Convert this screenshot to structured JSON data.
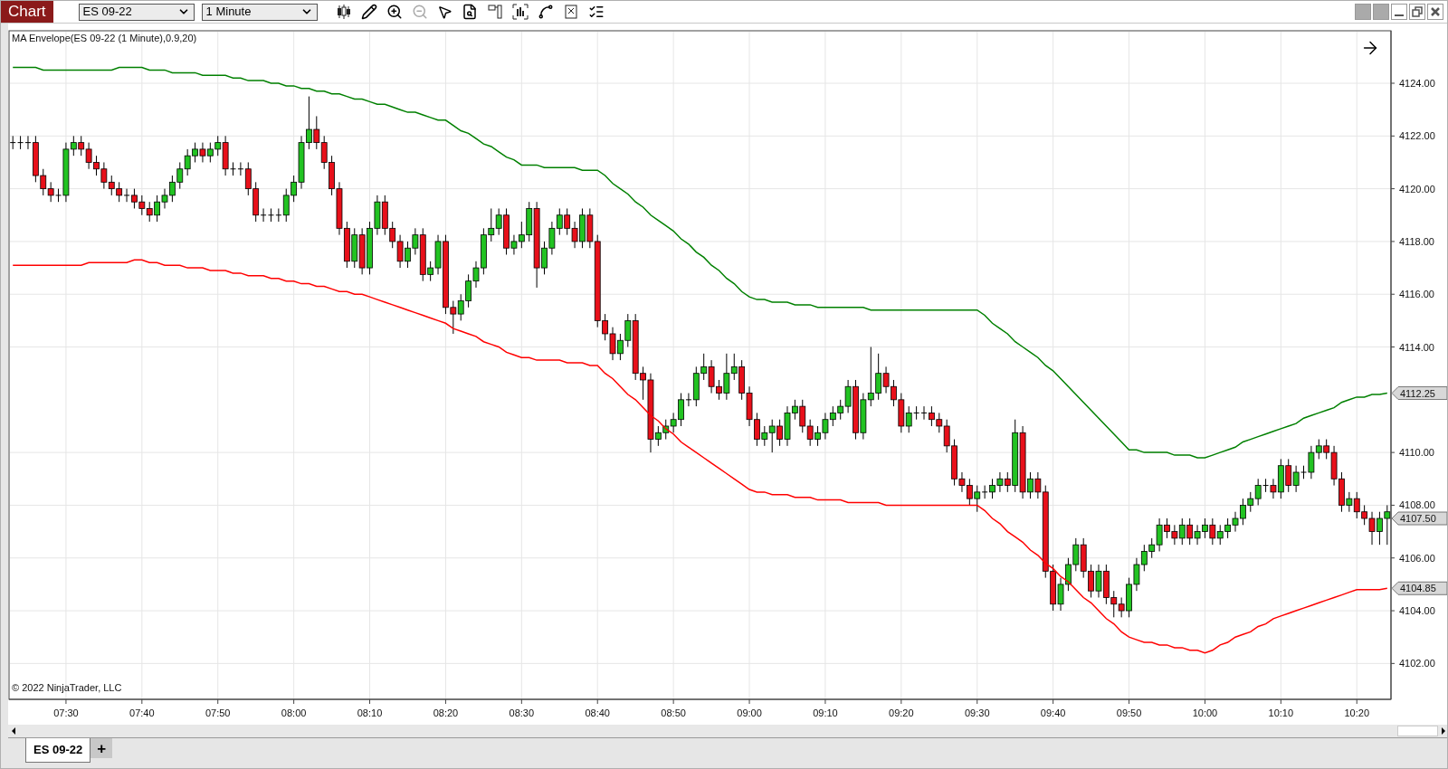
{
  "toolbar": {
    "title": "Chart",
    "instrument": "ES 09-22",
    "interval": "1 Minute"
  },
  "chart": {
    "legend": "MA Envelope(ES 09-22 (1 Minute),0.9,20)",
    "copyright": "© 2022 NinjaTrader, LLC",
    "price_markers": [
      {
        "label": "4112.25"
      },
      {
        "label": "4107.50"
      },
      {
        "label": "4104.85"
      }
    ],
    "chart_data": {
      "type": "candlestick",
      "grid": true,
      "ylim": [
        4100.64,
        4125.99
      ],
      "categories": [
        null,
        null,
        null,
        null,
        null,
        null,
        null,
        "07:30",
        null,
        null,
        null,
        null,
        null,
        null,
        null,
        null,
        null,
        "07:40",
        null,
        null,
        null,
        null,
        null,
        null,
        null,
        null,
        null,
        "07:50",
        null,
        null,
        null,
        null,
        null,
        null,
        null,
        null,
        null,
        "08:00",
        null,
        null,
        null,
        null,
        null,
        null,
        null,
        null,
        null,
        "08:10",
        null,
        null,
        null,
        null,
        null,
        null,
        null,
        null,
        null,
        "08:20",
        null,
        null,
        null,
        null,
        null,
        null,
        null,
        null,
        null,
        "08:30",
        null,
        null,
        null,
        null,
        null,
        null,
        null,
        null,
        null,
        "08:40",
        null,
        null,
        null,
        null,
        null,
        null,
        null,
        null,
        null,
        "08:50",
        null,
        null,
        null,
        null,
        null,
        null,
        null,
        null,
        null,
        "09:00",
        null,
        null,
        null,
        null,
        null,
        null,
        null,
        null,
        null,
        "09:10",
        null,
        null,
        null,
        null,
        null,
        null,
        null,
        null,
        null,
        "09:20",
        null,
        null,
        null,
        null,
        null,
        null,
        null,
        null,
        null,
        "09:30",
        null,
        null,
        null,
        null,
        null,
        null,
        null,
        null,
        null,
        "09:40",
        null,
        null,
        null,
        null,
        null,
        null,
        null,
        null,
        null,
        "09:50",
        null,
        null,
        null,
        null,
        null,
        null,
        null,
        null,
        null,
        "10:00",
        null,
        null,
        null,
        null,
        null,
        null,
        null,
        null,
        null,
        "10:10",
        null,
        null,
        null,
        null,
        null,
        null,
        null,
        null,
        null,
        "10:20",
        null,
        null,
        null,
        null
      ],
      "ohlc": [
        [
          4121.75,
          4122,
          4121.5,
          4121.75
        ],
        [
          4121.75,
          4122,
          4121.5,
          4121.75
        ],
        [
          4121.75,
          4122,
          4121.5,
          4121.75
        ],
        [
          4121.75,
          4122,
          4120.25,
          4120.5
        ],
        [
          4120.5,
          4120.75,
          4119.75,
          4120
        ],
        [
          4120,
          4120.25,
          4119.5,
          4119.75
        ],
        [
          4119.75,
          4120,
          4119.5,
          4119.75
        ],
        [
          4119.75,
          4121.75,
          4119.5,
          4121.5
        ],
        [
          4121.5,
          4122,
          4121.25,
          4121.75
        ],
        [
          4121.75,
          4122,
          4121.25,
          4121.5
        ],
        [
          4121.5,
          4121.75,
          4120.75,
          4121
        ],
        [
          4121,
          4121.25,
          4120.5,
          4120.75
        ],
        [
          4120.75,
          4121,
          4120,
          4120.25
        ],
        [
          4120.25,
          4120.5,
          4119.75,
          4120
        ],
        [
          4120,
          4120.25,
          4119.5,
          4119.75
        ],
        [
          4119.75,
          4120,
          4119.5,
          4119.75
        ],
        [
          4119.75,
          4120,
          4119.25,
          4119.5
        ],
        [
          4119.5,
          4119.75,
          4119,
          4119.25
        ],
        [
          4119.25,
          4119.5,
          4118.75,
          4119
        ],
        [
          4119,
          4119.75,
          4118.75,
          4119.5
        ],
        [
          4119.5,
          4120,
          4119.25,
          4119.75
        ],
        [
          4119.75,
          4120.5,
          4119.5,
          4120.25
        ],
        [
          4120.25,
          4121,
          4120,
          4120.75
        ],
        [
          4120.75,
          4121.5,
          4120.5,
          4121.25
        ],
        [
          4121.25,
          4121.75,
          4121,
          4121.5
        ],
        [
          4121.5,
          4121.75,
          4121,
          4121.25
        ],
        [
          4121.25,
          4121.75,
          4121,
          4121.5
        ],
        [
          4121.5,
          4122,
          4121.25,
          4121.75
        ],
        [
          4121.75,
          4122,
          4120.5,
          4120.75
        ],
        [
          4120.75,
          4121,
          4120.5,
          4120.75
        ],
        [
          4120.75,
          4121,
          4120.5,
          4120.75
        ],
        [
          4120.75,
          4121,
          4119.75,
          4120
        ],
        [
          4120,
          4120.25,
          4118.75,
          4119
        ],
        [
          4119,
          4119.25,
          4118.75,
          4119
        ],
        [
          4119,
          4119.25,
          4118.75,
          4119
        ],
        [
          4119,
          4119.25,
          4118.75,
          4119
        ],
        [
          4119,
          4120,
          4118.75,
          4119.75
        ],
        [
          4119.75,
          4120.5,
          4119.5,
          4120.25
        ],
        [
          4120.25,
          4122,
          4120,
          4121.75
        ],
        [
          4121.75,
          4123.5,
          4121.5,
          4122.25
        ],
        [
          4122.25,
          4122.75,
          4121.5,
          4121.75
        ],
        [
          4121.75,
          4122,
          4120.75,
          4121
        ],
        [
          4121,
          4121.25,
          4119.75,
          4120
        ],
        [
          4120,
          4120.25,
          4118.25,
          4118.5
        ],
        [
          4118.5,
          4118.75,
          4117,
          4117.25
        ],
        [
          4117.25,
          4118.5,
          4117,
          4118.25
        ],
        [
          4118.25,
          4118.5,
          4116.75,
          4117
        ],
        [
          4117,
          4118.75,
          4116.75,
          4118.5
        ],
        [
          4118.5,
          4119.75,
          4118.25,
          4119.5
        ],
        [
          4119.5,
          4119.75,
          4118.25,
          4118.5
        ],
        [
          4118.5,
          4118.75,
          4117.75,
          4118
        ],
        [
          4118,
          4118.25,
          4117,
          4117.25
        ],
        [
          4117.25,
          4118,
          4117,
          4117.75
        ],
        [
          4117.75,
          4118.5,
          4117.5,
          4118.25
        ],
        [
          4118.25,
          4118.5,
          4116.5,
          4116.75
        ],
        [
          4116.75,
          4117.25,
          4116.5,
          4117
        ],
        [
          4117,
          4118.25,
          4116.75,
          4118
        ],
        [
          4118,
          4118.25,
          4115.25,
          4115.5
        ],
        [
          4115.5,
          4115.75,
          4114.5,
          4115.25
        ],
        [
          4115.25,
          4116,
          4115,
          4115.75
        ],
        [
          4115.75,
          4116.75,
          4115.5,
          4116.5
        ],
        [
          4116.5,
          4117.25,
          4116.25,
          4117
        ],
        [
          4117,
          4118.5,
          4116.75,
          4118.25
        ],
        [
          4118.25,
          4119.25,
          4118,
          4118.5
        ],
        [
          4118.5,
          4119.25,
          4118.25,
          4119
        ],
        [
          4119,
          4119.25,
          4117.5,
          4117.75
        ],
        [
          4117.75,
          4118.25,
          4117.5,
          4118
        ],
        [
          4118,
          4118.75,
          4117.75,
          4118.25
        ],
        [
          4118.25,
          4119.5,
          4118,
          4119.25
        ],
        [
          4119.25,
          4119.5,
          4116.25,
          4117
        ],
        [
          4117,
          4118,
          4116.75,
          4117.75
        ],
        [
          4117.75,
          4118.75,
          4117.5,
          4118.5
        ],
        [
          4118.5,
          4119.25,
          4118.25,
          4119
        ],
        [
          4119,
          4119.25,
          4118.25,
          4118.5
        ],
        [
          4118.5,
          4118.75,
          4117.75,
          4118
        ],
        [
          4118,
          4119.25,
          4117.75,
          4119
        ],
        [
          4119,
          4119.25,
          4117.75,
          4118
        ],
        [
          4118,
          4118.25,
          4114.75,
          4115
        ],
        [
          4115,
          4115.25,
          4114.25,
          4114.5
        ],
        [
          4114.5,
          4114.75,
          4113.5,
          4113.75
        ],
        [
          4113.75,
          4114.5,
          4113.5,
          4114.25
        ],
        [
          4114.25,
          4115.25,
          4114,
          4115
        ],
        [
          4115,
          4115.25,
          4112.75,
          4113
        ],
        [
          4113,
          4113.25,
          4112,
          4112.75
        ],
        [
          4112.75,
          4113,
          4110,
          4110.5
        ],
        [
          4110.5,
          4111,
          4110.25,
          4110.75
        ],
        [
          4110.75,
          4111.25,
          4110.5,
          4111
        ],
        [
          4111,
          4111.5,
          4110.75,
          4111.25
        ],
        [
          4111.25,
          4112.25,
          4111,
          4112
        ],
        [
          4112,
          4112.25,
          4111.75,
          4112
        ],
        [
          4112,
          4113.25,
          4111.75,
          4113
        ],
        [
          4113,
          4113.75,
          4112.75,
          4113.25
        ],
        [
          4113.25,
          4113.5,
          4112.25,
          4112.5
        ],
        [
          4112.5,
          4112.75,
          4112,
          4112.25
        ],
        [
          4112.25,
          4113.75,
          4112,
          4113
        ],
        [
          4113,
          4113.75,
          4112.75,
          4113.25
        ],
        [
          4113.25,
          4113.5,
          4112,
          4112.25
        ],
        [
          4112.25,
          4112.5,
          4111,
          4111.25
        ],
        [
          4111.25,
          4111.5,
          4110.25,
          4110.5
        ],
        [
          4110.5,
          4111,
          4110.25,
          4110.75
        ],
        [
          4110.75,
          4111.25,
          4110,
          4111
        ],
        [
          4111,
          4111.25,
          4110.25,
          4110.5
        ],
        [
          4110.5,
          4111.75,
          4110.25,
          4111.5
        ],
        [
          4111.5,
          4112,
          4111.25,
          4111.75
        ],
        [
          4111.75,
          4112,
          4110.75,
          4111
        ],
        [
          4111,
          4111.25,
          4110.25,
          4110.5
        ],
        [
          4110.5,
          4111,
          4110.25,
          4110.75
        ],
        [
          4110.75,
          4111.5,
          4110.5,
          4111.25
        ],
        [
          4111.25,
          4111.75,
          4111,
          4111.5
        ],
        [
          4111.5,
          4112,
          4111.25,
          4111.75
        ],
        [
          4111.75,
          4112.75,
          4111.5,
          4112.5
        ],
        [
          4112.5,
          4112.75,
          4110.5,
          4110.75
        ],
        [
          4110.75,
          4112.25,
          4110.5,
          4112
        ],
        [
          4112,
          4114,
          4111.75,
          4112.25
        ],
        [
          4112.25,
          4113.75,
          4112,
          4113
        ],
        [
          4113,
          4113.25,
          4112.25,
          4112.5
        ],
        [
          4112.5,
          4112.75,
          4111.75,
          4112
        ],
        [
          4112,
          4112.25,
          4110.75,
          4111
        ],
        [
          4111,
          4111.75,
          4110.75,
          4111.5
        ],
        [
          4111.5,
          4111.75,
          4111.25,
          4111.5
        ],
        [
          4111.5,
          4111.75,
          4111.25,
          4111.5
        ],
        [
          4111.5,
          4111.75,
          4111,
          4111.25
        ],
        [
          4111.25,
          4111.5,
          4110.75,
          4111
        ],
        [
          4111,
          4111.25,
          4110,
          4110.25
        ],
        [
          4110.25,
          4110.5,
          4108.75,
          4109
        ],
        [
          4109,
          4109.25,
          4108.5,
          4108.75
        ],
        [
          4108.75,
          4109,
          4108,
          4108.25
        ],
        [
          4108.25,
          4108.75,
          4107.75,
          4108.5
        ],
        [
          4108.5,
          4108.75,
          4108.25,
          4108.5
        ],
        [
          4108.5,
          4109,
          4108.25,
          4108.75
        ],
        [
          4108.75,
          4109.25,
          4108.5,
          4109
        ],
        [
          4109,
          4109.25,
          4108.5,
          4108.75
        ],
        [
          4108.75,
          4111.25,
          4108.5,
          4110.75
        ],
        [
          4110.75,
          4111,
          4108.25,
          4108.5
        ],
        [
          4108.5,
          4109.25,
          4108.25,
          4109
        ],
        [
          4109,
          4109.25,
          4108.25,
          4108.5
        ],
        [
          4108.5,
          4108.75,
          4105.25,
          4105.5
        ],
        [
          4105.5,
          4105.75,
          4104,
          4104.25
        ],
        [
          4104.25,
          4105.25,
          4104,
          4105
        ],
        [
          4105,
          4106,
          4104.75,
          4105.75
        ],
        [
          4105.75,
          4106.75,
          4105.5,
          4106.5
        ],
        [
          4106.5,
          4106.75,
          4105.25,
          4105.5
        ],
        [
          4105.5,
          4105.75,
          4104.5,
          4104.75
        ],
        [
          4104.75,
          4105.75,
          4104.5,
          4105.5
        ],
        [
          4105.5,
          4105.75,
          4104.25,
          4104.5
        ],
        [
          4104.5,
          4104.75,
          4103.75,
          4104.25
        ],
        [
          4104.25,
          4104.5,
          4103.75,
          4104
        ],
        [
          4104,
          4105.25,
          4103.75,
          4105
        ],
        [
          4105,
          4106,
          4104.75,
          4105.75
        ],
        [
          4105.75,
          4106.5,
          4105.5,
          4106.25
        ],
        [
          4106.25,
          4106.75,
          4106,
          4106.5
        ],
        [
          4106.5,
          4107.5,
          4106.25,
          4107.25
        ],
        [
          4107.25,
          4107.5,
          4106.75,
          4107
        ],
        [
          4107,
          4107.25,
          4106.5,
          4106.75
        ],
        [
          4106.75,
          4107.5,
          4106.5,
          4107.25
        ],
        [
          4107.25,
          4107.5,
          4106.5,
          4106.75
        ],
        [
          4106.75,
          4107.25,
          4106.5,
          4107
        ],
        [
          4107,
          4107.5,
          4106.75,
          4107.25
        ],
        [
          4107.25,
          4107.5,
          4106.5,
          4106.75
        ],
        [
          4106.75,
          4107.25,
          4106.5,
          4107
        ],
        [
          4107,
          4107.5,
          4106.75,
          4107.25
        ],
        [
          4107.25,
          4107.75,
          4107,
          4107.5
        ],
        [
          4107.5,
          4108.25,
          4107.25,
          4108
        ],
        [
          4108,
          4108.5,
          4107.75,
          4108.25
        ],
        [
          4108.25,
          4109,
          4108,
          4108.75
        ],
        [
          4108.75,
          4109,
          4108.5,
          4108.75
        ],
        [
          4108.75,
          4109,
          4108.25,
          4108.5
        ],
        [
          4108.5,
          4109.75,
          4108.25,
          4109.5
        ],
        [
          4109.5,
          4109.75,
          4108.5,
          4108.75
        ],
        [
          4108.75,
          4109.5,
          4108.5,
          4109.25
        ],
        [
          4109.25,
          4109.5,
          4109,
          4109.25
        ],
        [
          4109.25,
          4110.25,
          4109,
          4110
        ],
        [
          4110,
          4110.5,
          4109.75,
          4110.25
        ],
        [
          4110.25,
          4110.5,
          4109.75,
          4110
        ],
        [
          4110,
          4110.25,
          4108.75,
          4109
        ],
        [
          4109,
          4109.25,
          4107.75,
          4108
        ],
        [
          4108,
          4108.5,
          4107.75,
          4108.25
        ],
        [
          4108.25,
          4108.5,
          4107.5,
          4107.75
        ],
        [
          4107.75,
          4108,
          4107.25,
          4107.5
        ],
        [
          4107.5,
          4107.75,
          4106.5,
          4107
        ],
        [
          4107,
          4107.75,
          4106.5,
          4107.5
        ],
        [
          4107.5,
          4108,
          4106.5,
          4107.75
        ]
      ],
      "series": [
        {
          "type": "line",
          "color": "#008000",
          "values": [
            4124.6,
            4124.6,
            4124.6,
            4124.6,
            4124.5,
            4124.5,
            4124.5,
            4124.5,
            4124.5,
            4124.5,
            4124.5,
            4124.5,
            4124.5,
            4124.5,
            4124.6,
            4124.6,
            4124.6,
            4124.6,
            4124.5,
            4124.5,
            4124.5,
            4124.4,
            4124.4,
            4124.4,
            4124.4,
            4124.3,
            4124.3,
            4124.3,
            4124.3,
            4124.2,
            4124.2,
            4124.1,
            4124.1,
            4124.1,
            4124.0,
            4124.0,
            4123.9,
            4123.9,
            4123.8,
            4123.8,
            4123.7,
            4123.7,
            4123.6,
            4123.6,
            4123.5,
            4123.4,
            4123.4,
            4123.3,
            4123.2,
            4123.2,
            4123.1,
            4123.0,
            4122.9,
            4122.9,
            4122.8,
            4122.7,
            4122.6,
            4122.6,
            4122.4,
            4122.2,
            4122.1,
            4121.9,
            4121.7,
            4121.6,
            4121.4,
            4121.2,
            4121.1,
            4120.9,
            4120.9,
            4120.9,
            4120.8,
            4120.8,
            4120.8,
            4120.8,
            4120.8,
            4120.7,
            4120.7,
            4120.7,
            4120.5,
            4120.2,
            4120.0,
            4119.8,
            4119.5,
            4119.3,
            4119.0,
            4118.8,
            4118.6,
            4118.4,
            4118.1,
            4117.9,
            4117.6,
            4117.4,
            4117.1,
            4116.9,
            4116.6,
            4116.4,
            4116.1,
            4115.9,
            4115.8,
            4115.8,
            4115.7,
            4115.7,
            4115.7,
            4115.6,
            4115.6,
            4115.6,
            4115.5,
            4115.5,
            4115.5,
            4115.5,
            4115.5,
            4115.5,
            4115.5,
            4115.4,
            4115.4,
            4115.4,
            4115.4,
            4115.4,
            4115.4,
            4115.4,
            4115.4,
            4115.4,
            4115.4,
            4115.4,
            4115.4,
            4115.4,
            4115.4,
            4115.4,
            4115.2,
            4114.9,
            4114.7,
            4114.5,
            4114.2,
            4114.0,
            4113.8,
            4113.6,
            4113.3,
            4113.1,
            4112.8,
            4112.5,
            4112.2,
            4111.9,
            4111.6,
            4111.3,
            4111.0,
            4110.7,
            4110.4,
            4110.1,
            4110.1,
            4110.0,
            4110.0,
            4110.0,
            4110.0,
            4109.9,
            4109.9,
            4109.9,
            4109.8,
            4109.8,
            4109.9,
            4110.0,
            4110.1,
            4110.2,
            4110.4,
            4110.5,
            4110.6,
            4110.7,
            4110.8,
            4110.9,
            4111.0,
            4111.1,
            4111.3,
            4111.4,
            4111.5,
            4111.6,
            4111.7,
            4111.9,
            4112.0,
            4112.1,
            4112.1,
            4112.2,
            4112.2,
            4112.25
          ]
        },
        {
          "type": "line",
          "color": "#ff0000",
          "values": [
            4117.1,
            4117.1,
            4117.1,
            4117.1,
            4117.1,
            4117.1,
            4117.1,
            4117.1,
            4117.1,
            4117.1,
            4117.2,
            4117.2,
            4117.2,
            4117.2,
            4117.2,
            4117.2,
            4117.3,
            4117.3,
            4117.2,
            4117.2,
            4117.1,
            4117.1,
            4117.1,
            4117.0,
            4117.0,
            4117.0,
            4116.9,
            4116.9,
            4116.9,
            4116.8,
            4116.8,
            4116.7,
            4116.7,
            4116.7,
            4116.6,
            4116.6,
            4116.5,
            4116.5,
            4116.4,
            4116.4,
            4116.3,
            4116.3,
            4116.2,
            4116.1,
            4116.1,
            4116.0,
            4116.0,
            4115.9,
            4115.8,
            4115.7,
            4115.6,
            4115.5,
            4115.4,
            4115.3,
            4115.2,
            4115.1,
            4115.0,
            4114.9,
            4114.7,
            4114.6,
            4114.5,
            4114.4,
            4114.2,
            4114.1,
            4114.0,
            4113.8,
            4113.7,
            4113.6,
            4113.6,
            4113.5,
            4113.5,
            4113.5,
            4113.5,
            4113.4,
            4113.4,
            4113.4,
            4113.3,
            4113.3,
            4113.0,
            4112.8,
            4112.5,
            4112.2,
            4112.0,
            4111.7,
            4111.4,
            4111.2,
            4110.9,
            4110.7,
            4110.4,
            4110.2,
            4110.0,
            4109.8,
            4109.6,
            4109.4,
            4109.2,
            4109.0,
            4108.8,
            4108.6,
            4108.5,
            4108.5,
            4108.4,
            4108.4,
            4108.4,
            4108.3,
            4108.3,
            4108.3,
            4108.2,
            4108.2,
            4108.2,
            4108.2,
            4108.1,
            4108.1,
            4108.1,
            4108.1,
            4108.1,
            4108.0,
            4108.0,
            4108.0,
            4108.0,
            4108.0,
            4108.0,
            4108.0,
            4108.0,
            4108.0,
            4108.0,
            4108.0,
            4108.0,
            4108.0,
            4107.8,
            4107.5,
            4107.3,
            4107.0,
            4106.8,
            4106.6,
            4106.3,
            4106.1,
            4105.8,
            4105.6,
            4105.3,
            4105.1,
            4104.8,
            4104.5,
            4104.3,
            4104.0,
            4103.7,
            4103.5,
            4103.2,
            4103.0,
            4102.9,
            4102.8,
            4102.8,
            4102.7,
            4102.7,
            4102.6,
            4102.6,
            4102.5,
            4102.5,
            4102.4,
            4102.5,
            4102.7,
            4102.8,
            4103.0,
            4103.1,
            4103.2,
            4103.4,
            4103.5,
            4103.7,
            4103.8,
            4103.9,
            4104.0,
            4104.1,
            4104.2,
            4104.3,
            4104.4,
            4104.5,
            4104.6,
            4104.7,
            4104.8,
            4104.8,
            4104.8,
            4104.8,
            4104.85
          ]
        }
      ],
      "yticks": [
        {
          "value": 4102,
          "label": "4102.00"
        },
        {
          "value": 4104,
          "label": "4104.00"
        },
        {
          "value": 4106,
          "label": "4106.00"
        },
        {
          "value": 4108,
          "label": "4108.00"
        },
        {
          "value": 4110,
          "label": "4110.00"
        },
        {
          "value": 4114,
          "label": "4114.00"
        },
        {
          "value": 4116,
          "label": "4116.00"
        },
        {
          "value": 4118,
          "label": "4118.00"
        },
        {
          "value": 4120,
          "label": "4120.00"
        },
        {
          "value": 4122,
          "label": "4122.00"
        },
        {
          "value": 4124,
          "label": "4124.00"
        }
      ]
    }
  },
  "tabs": [
    {
      "label": "ES 09-22",
      "selected": true
    }
  ],
  "add_tab": "+"
}
